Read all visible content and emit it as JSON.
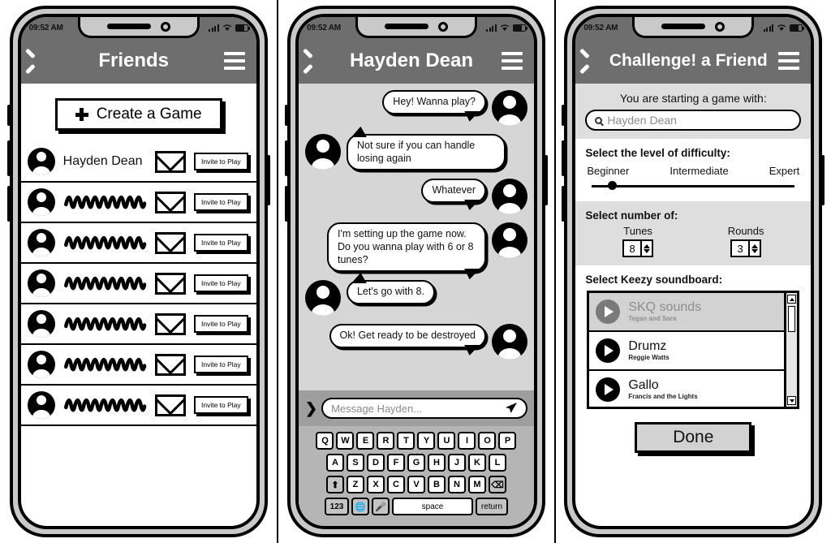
{
  "statusbar": {
    "time": "09:52 AM",
    "signal_icon": "signal-bars-icon",
    "wifi_icon": "wifi-icon",
    "battery_icon": "battery-icon"
  },
  "screen1": {
    "appbar": {
      "title": "Friends",
      "back_icon": "chevron-left-icon",
      "menu_icon": "hamburger-menu-icon"
    },
    "create_button": {
      "label": "Create a Game",
      "icon": "plus-icon"
    },
    "friends": [
      {
        "name": "Hayden Dean",
        "scribbled": false,
        "mail_icon": "envelope-icon",
        "invite_label": "Invite to Play"
      },
      {
        "name": "",
        "scribbled": true,
        "mail_icon": "envelope-icon",
        "invite_label": "Invite to Play"
      },
      {
        "name": "",
        "scribbled": true,
        "mail_icon": "envelope-icon",
        "invite_label": "Invite to Play"
      },
      {
        "name": "",
        "scribbled": true,
        "mail_icon": "envelope-icon",
        "invite_label": "Invite to Play"
      },
      {
        "name": "",
        "scribbled": true,
        "mail_icon": "envelope-icon",
        "invite_label": "Invite to Play"
      },
      {
        "name": "",
        "scribbled": true,
        "mail_icon": "envelope-icon",
        "invite_label": "Invite to Play"
      },
      {
        "name": "",
        "scribbled": true,
        "mail_icon": "envelope-icon",
        "invite_label": "Invite to Play"
      }
    ]
  },
  "screen2": {
    "appbar": {
      "title": "Hayden Dean",
      "back_icon": "chevron-left-icon",
      "menu_icon": "hamburger-menu-icon"
    },
    "messages": [
      {
        "text": "Hey! Wanna play?",
        "side": "right"
      },
      {
        "text": "Not sure if you can handle losing again",
        "side": "left"
      },
      {
        "text": "Whatever",
        "side": "right"
      },
      {
        "text": "I'm setting up the game now. Do you wanna play with 6 or 8 tunes?",
        "side": "right"
      },
      {
        "text": "Let's go with 8.",
        "side": "left"
      },
      {
        "text": "Ok! Get ready to be destroyed",
        "side": "right"
      }
    ],
    "input": {
      "placeholder": "Message Hayden...",
      "expand_icon": "chevron-right-icon",
      "send_icon": "send-paper-plane-icon"
    },
    "keyboard": {
      "row1": [
        "Q",
        "W",
        "E",
        "R",
        "T",
        "Y",
        "U",
        "I",
        "O",
        "P"
      ],
      "row2": [
        "A",
        "S",
        "D",
        "F",
        "G",
        "H",
        "J",
        "K",
        "L"
      ],
      "row3": [
        "Z",
        "X",
        "C",
        "V",
        "B",
        "N",
        "M"
      ],
      "shift_icon": "shift-arrow-up-icon",
      "backspace_icon": "backspace-icon",
      "numbers_label": "123",
      "globe_icon": "globe-icon",
      "mic_icon": "microphone-icon",
      "space_label": "space",
      "return_label": "return"
    }
  },
  "screen3": {
    "appbar": {
      "title": "Challenge! a Friend",
      "back_icon": "chevron-left-icon",
      "menu_icon": "hamburger-menu-icon"
    },
    "starting_with": {
      "label": "You are starting a game with:",
      "value": "Hayden Dean",
      "search_icon": "search-magnifier-icon"
    },
    "difficulty": {
      "label": "Select the level of difficulty:",
      "options": [
        "Beginner",
        "Intermediate",
        "Expert"
      ],
      "selected_percent": 8
    },
    "numbers": {
      "label": "Select number of:",
      "fields": [
        {
          "label": "Tunes",
          "value": "8",
          "up_icon": "arrow-up-icon",
          "down_icon": "arrow-down-icon"
        },
        {
          "label": "Rounds",
          "value": "3",
          "up_icon": "arrow-up-icon",
          "down_icon": "arrow-down-icon"
        }
      ]
    },
    "soundboard": {
      "label": "Select Keezy soundboard:",
      "items": [
        {
          "name": "SKQ sounds",
          "artist": "Tegan and Sara",
          "selected": true,
          "play_icon": "play-circle-icon"
        },
        {
          "name": "Drumz",
          "artist": "Reggie Watts",
          "selected": false,
          "play_icon": "play-circle-icon"
        },
        {
          "name": "Gallo",
          "artist": "Francis and the Lights",
          "selected": false,
          "play_icon": "play-circle-icon"
        }
      ],
      "scroll_up_icon": "scroll-up-arrow-icon",
      "scroll_down_icon": "scroll-down-arrow-icon"
    },
    "done_button": {
      "label": "Done"
    }
  }
}
